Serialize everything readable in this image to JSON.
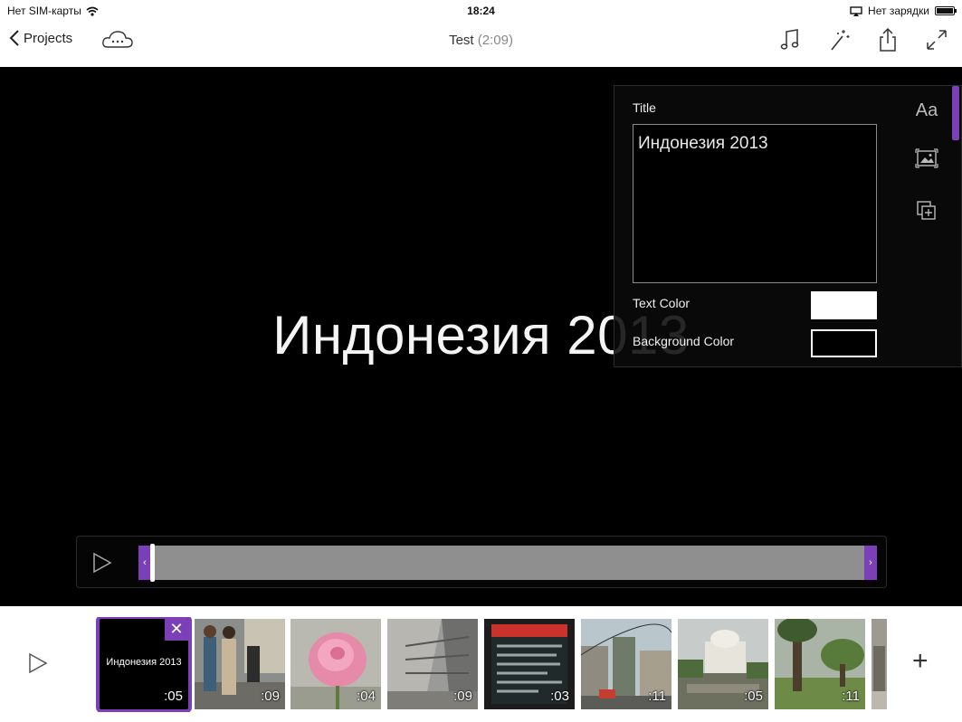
{
  "status": {
    "carrier": "Нет SIM-карты",
    "time": "18:24",
    "charging": "Нет зарядки"
  },
  "nav": {
    "back_label": "Projects",
    "title": "Test",
    "duration": "(2:09)"
  },
  "preview": {
    "title_text": "Индонезия 2013"
  },
  "panel": {
    "title_label": "Title",
    "title_value": "Индонезия 2013",
    "text_color_label": "Text Color",
    "text_color": "#ffffff",
    "bg_color_label": "Background Color",
    "bg_color": "#000000",
    "font_tool": "Aa"
  },
  "scrubber": {
    "left_handle": "‹",
    "right_handle": "›"
  },
  "timeline": {
    "clips": [
      {
        "kind": "title",
        "thumb_text": "Индонезия 2013",
        "duration": ":05",
        "selected": true
      },
      {
        "kind": "photo",
        "scene": "people-walking-station",
        "duration": ":09"
      },
      {
        "kind": "photo",
        "scene": "pink-rose",
        "duration": ":04"
      },
      {
        "kind": "photo",
        "scene": "building-interior",
        "duration": ":09"
      },
      {
        "kind": "photo",
        "scene": "screen-display",
        "duration": ":03"
      },
      {
        "kind": "photo",
        "scene": "city-street",
        "duration": ":11"
      },
      {
        "kind": "photo",
        "scene": "monument-statue",
        "duration": ":05"
      },
      {
        "kind": "photo",
        "scene": "green-park",
        "duration": ":11"
      },
      {
        "kind": "photo",
        "scene": "temple-partial",
        "duration": ""
      }
    ],
    "close_glyph": "✕",
    "add_glyph": "+"
  },
  "colors": {
    "accent": "#7b3fb8",
    "preview_bg": "#000000",
    "track": "#8f8f8f"
  }
}
